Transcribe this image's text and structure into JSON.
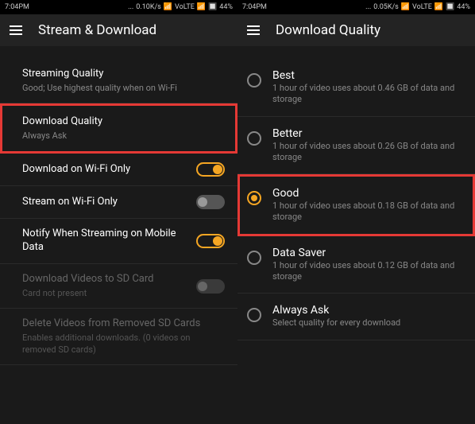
{
  "status_bar": {
    "time_left": "7:04PM",
    "speed_left": "0.10K/s",
    "network_left": "VoLTE",
    "battery_left": "44%",
    "time_right": "7:04PM",
    "speed_right": "0.05K/s",
    "network_right": "VoLTE",
    "battery_right": "44%",
    "dots": "..."
  },
  "left_screen": {
    "header_title": "Stream & Download",
    "items": [
      {
        "title": "Streaming Quality",
        "subtitle": "Good; Use highest quality when on Wi-Fi"
      },
      {
        "title": "Download Quality",
        "subtitle": "Always Ask"
      },
      {
        "title": "Download on Wi-Fi Only"
      },
      {
        "title": "Stream on Wi-Fi Only"
      },
      {
        "title": "Notify When Streaming on Mobile Data"
      },
      {
        "title": "Download Videos to SD Card",
        "subtitle": "Card not present"
      },
      {
        "title": "Delete Videos from Removed SD Cards",
        "subtitle": "Enables additional downloads. (0 videos on removed SD cards)"
      }
    ]
  },
  "right_screen": {
    "header_title": "Download Quality",
    "items": [
      {
        "title": "Best",
        "subtitle": "1 hour of video uses about 0.46 GB of data and storage"
      },
      {
        "title": "Better",
        "subtitle": "1 hour of video uses about 0.26 GB of data and storage"
      },
      {
        "title": "Good",
        "subtitle": "1 hour of video uses about 0.18 GB of data and storage"
      },
      {
        "title": "Data Saver",
        "subtitle": "1 hour of video uses about 0.12 GB of data and storage"
      },
      {
        "title": "Always Ask",
        "subtitle": "Select quality for every download"
      }
    ]
  }
}
